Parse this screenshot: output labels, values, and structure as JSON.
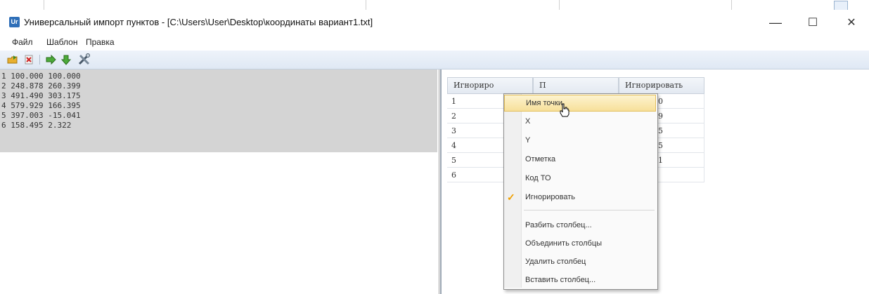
{
  "window": {
    "title": "Универсальный импорт пунктов - [C:\\Users\\User\\Desktop\\координаты вариант1.txt]",
    "app_icon_text": "Ur",
    "minimize_glyph": "—",
    "maximize_glyph": "☐",
    "close_glyph": "✕"
  },
  "menu": {
    "items": [
      "Файл",
      "Шаблон",
      "Правка"
    ]
  },
  "toolbar": {
    "icons": [
      "open-icon",
      "delete-icon",
      "import-icon",
      "export-icon",
      "settings-tools-icon"
    ]
  },
  "source_text": {
    "lines": [
      "1 100.000 100.000",
      "2 248.878 260.399",
      "3 491.490 303.175",
      "4 579.929 166.395",
      "5 397.003 -15.041",
      "6 158.495 2.322"
    ]
  },
  "grid": {
    "headers": [
      "Игнориро",
      "П",
      "Игнорировать"
    ],
    "col1": [
      "1",
      "2",
      "3",
      "4",
      "5",
      "6"
    ],
    "col3": [
      "0",
      "9",
      "5",
      "5",
      "1",
      ""
    ]
  },
  "context_menu": {
    "items": [
      {
        "label": "Имя точки"
      },
      {
        "label": "X"
      },
      {
        "label": "Y"
      },
      {
        "label": "Отметка"
      },
      {
        "label": "Код ТО"
      },
      {
        "label": "Игнорировать",
        "check": "✓"
      },
      {
        "label": "Разбить столбец..."
      },
      {
        "label": "Объединить столбцы"
      },
      {
        "label": "Удалить столбец"
      },
      {
        "label": "Вставить столбец..."
      }
    ],
    "highlighted_index": 0,
    "accent_color": "#f7e09a"
  }
}
